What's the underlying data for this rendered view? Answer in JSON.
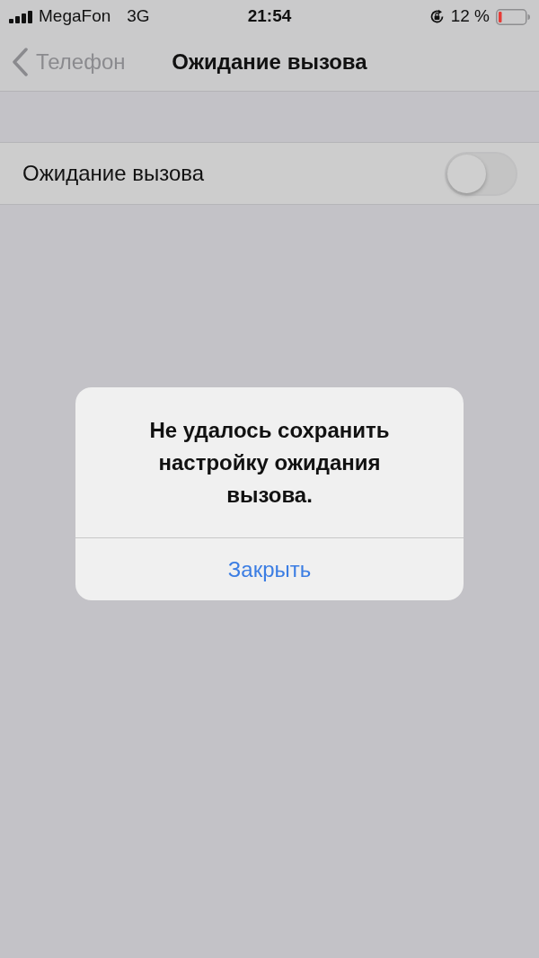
{
  "status_bar": {
    "carrier": "MegaFon",
    "network": "3G",
    "time": "21:54",
    "battery_text": "12 %"
  },
  "nav_bar": {
    "back_label": "Телефон",
    "title": "Ожидание вызова"
  },
  "settings": [
    {
      "label": "Ожидание вызова",
      "on": false
    }
  ],
  "alert": {
    "message": "Не удалось сохранить настройку ожидания вызова.",
    "buttons": [
      "Закрыть"
    ]
  }
}
